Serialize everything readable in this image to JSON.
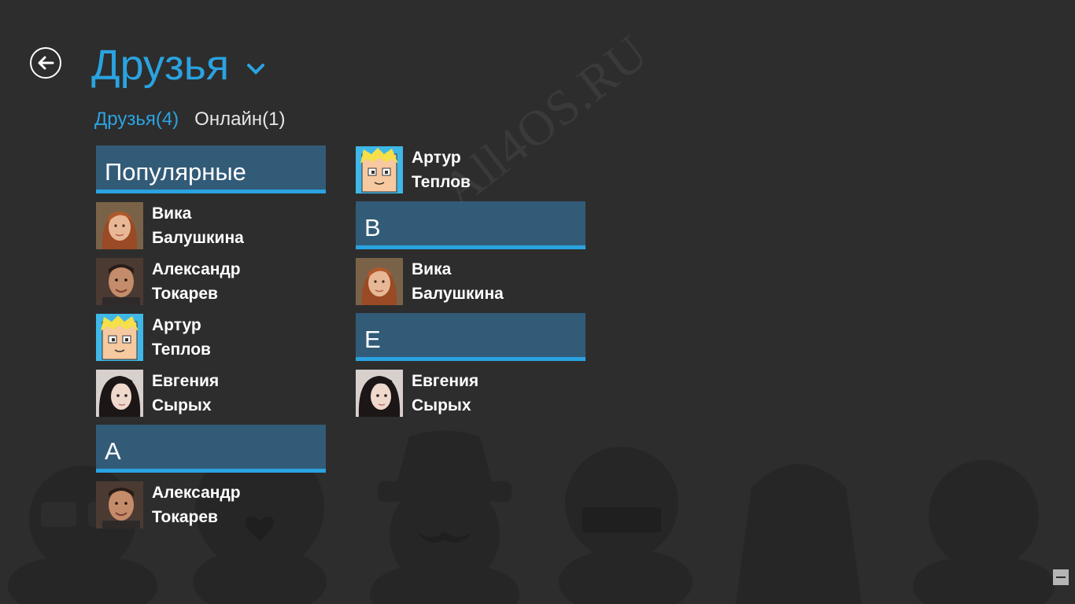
{
  "header": {
    "title": "Друзья",
    "back_icon": "back-arrow-icon",
    "chevron_icon": "chevron-down-icon"
  },
  "filters": [
    {
      "label": "Друзья(4)",
      "active": true
    },
    {
      "label": "Онлайн(1)",
      "active": false
    }
  ],
  "watermark": "All4OS.RU",
  "colors": {
    "accent": "#2aa3e0",
    "group_header_bg": "#325b78",
    "background": "#2d2d2d"
  },
  "groups": {
    "popular": "Популярные",
    "a": "А",
    "v": "В",
    "e": "Е"
  },
  "friends": {
    "vika": {
      "first": "Вика",
      "last": "Балушкина",
      "avatar": "avatar-vika"
    },
    "alexander": {
      "first": "Александр",
      "last": "Токарев",
      "avatar": "avatar-alexander"
    },
    "artur": {
      "first": "Артур",
      "last": "Теплов",
      "avatar": "avatar-artur"
    },
    "evgenia": {
      "first": "Евгения",
      "last": "Сырых",
      "avatar": "avatar-evgenia"
    }
  }
}
